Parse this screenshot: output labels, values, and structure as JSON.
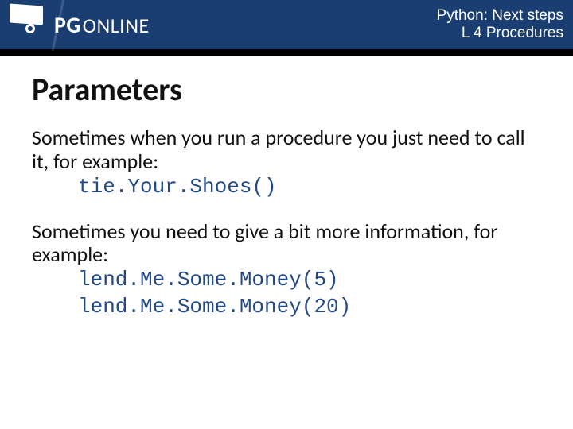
{
  "header": {
    "brand_pg": "PG",
    "brand_online": "ONLINE",
    "crumb_line1": "Python: Next steps",
    "crumb_line2": "L 4 Procedures"
  },
  "slide": {
    "title": "Parameters",
    "p1": "Sometimes when you run a procedure you just need to call it, for example:",
    "code1": "tie.Your.Shoes()",
    "p2": "Sometimes you need to give a bit more information, for example:",
    "code2a": "lend.Me.Some.Money(5)",
    "code2b": "lend.Me.Some.Money(20)"
  }
}
